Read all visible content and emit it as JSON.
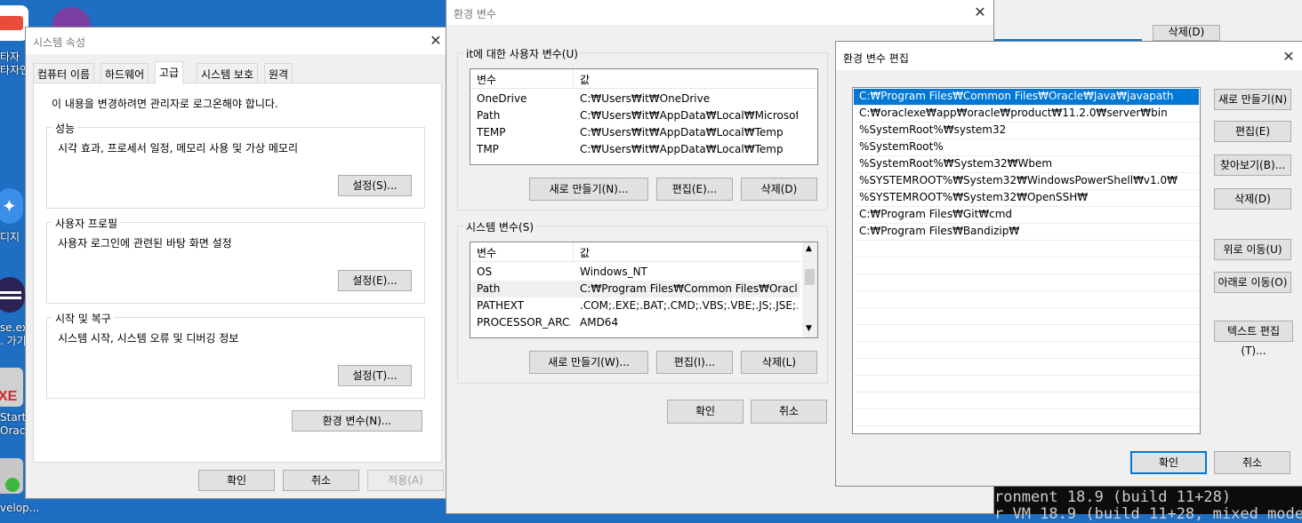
{
  "desktop": {
    "icons": [
      {
        "name": "keyboard-practice-icon",
        "label": "타자연습",
        "label_top": "타자"
      },
      {
        "name": "github-icon",
        "label": ""
      },
      {
        "name": "edge-icon",
        "label": "디지"
      },
      {
        "name": "eclipse-icon",
        "label": "se.exe",
        "label2": ". 가기"
      },
      {
        "name": "oracle-exe-icon",
        "label": "Starte",
        "label2": "Oracl"
      },
      {
        "name": "developer-icon",
        "label": "velop..."
      }
    ]
  },
  "sys_props": {
    "title": "시스템 속성",
    "tabs": [
      "컴퓨터 이름",
      "하드웨어",
      "고급",
      "시스템 보호",
      "원격"
    ],
    "active_tab": "고급",
    "admin_note": "이 내용을 변경하려면 관리자로 로그온해야 합니다.",
    "perf": {
      "title": "성능",
      "desc": "시각 효과, 프로세서 일정, 메모리 사용 및 가상 메모리",
      "button": "설정(S)..."
    },
    "profile": {
      "title": "사용자 프로필",
      "desc": "사용자 로그인에 관련된 바탕 화면 설정",
      "button": "설정(E)..."
    },
    "startup": {
      "title": "시작 및 복구",
      "desc": "시스템 시작, 시스템 오류 및 디버깅 정보",
      "button": "설정(T)..."
    },
    "env_button": "환경 변수(N)...",
    "ok": "확인",
    "cancel": "취소",
    "apply": "적용(A)"
  },
  "env_vars": {
    "title": "환경 변수",
    "user_group": "it에 대한 사용자 변수(U)",
    "col_var": "변수",
    "col_val": "값",
    "user_rows": [
      {
        "var": "OneDrive",
        "val": "C:₩Users₩it₩OneDrive"
      },
      {
        "var": "Path",
        "val": "C:₩Users₩it₩AppData₩Local₩Microsoft₩..."
      },
      {
        "var": "TEMP",
        "val": "C:₩Users₩it₩AppData₩Local₩Temp"
      },
      {
        "var": "TMP",
        "val": "C:₩Users₩it₩AppData₩Local₩Temp"
      }
    ],
    "user_buttons": {
      "new": "새로 만들기(N)...",
      "edit": "편집(E)...",
      "delete": "삭제(D)"
    },
    "sys_group": "시스템 변수(S)",
    "sys_rows": [
      {
        "var": "OS",
        "val": "Windows_NT"
      },
      {
        "var": "Path",
        "val": "C:₩Program Files₩Common Files₩Oracle₩..."
      },
      {
        "var": "PATHEXT",
        "val": ".COM;.EXE;.BAT;.CMD;.VBS;.VBE;.JS;.JSE;.W..."
      },
      {
        "var": "PROCESSOR_ARC...",
        "val": "AMD64"
      }
    ],
    "sys_buttons": {
      "new": "새로 만들기(W)...",
      "edit": "편집(I)...",
      "delete": "삭제(L)"
    },
    "ok": "확인",
    "cancel": "취소"
  },
  "background_window": {
    "delete_button": "삭제(D)"
  },
  "edit_env": {
    "title": "환경 변수 편집",
    "entries": [
      "C:₩Program Files₩Common Files₩Oracle₩Java₩javapath",
      "C:₩oraclexe₩app₩oracle₩product₩11.2.0₩server₩bin",
      "%SystemRoot%₩system32",
      "%SystemRoot%",
      "%SystemRoot%₩System32₩Wbem",
      "%SYSTEMROOT%₩System32₩WindowsPowerShell₩v1.0₩",
      "%SYSTEMROOT%₩System32₩OpenSSH₩",
      "C:₩Program Files₩Git₩cmd",
      "C:₩Program Files₩Bandizip₩"
    ],
    "selected_index": 0,
    "buttons": {
      "new": "새로 만들기(N)",
      "edit": "편집(E)",
      "browse": "찾아보기(B)...",
      "delete": "삭제(D)",
      "up": "위로 이동(U)",
      "down": "아래로 이동(O)",
      "text_edit": "텍스트 편집(T)..."
    },
    "ok": "확인",
    "cancel": "취소"
  },
  "console": {
    "line1": "ronment 18.9 (build 11+28)",
    "line2": "r VM 18.9 (build 11+28, mixed mode"
  }
}
